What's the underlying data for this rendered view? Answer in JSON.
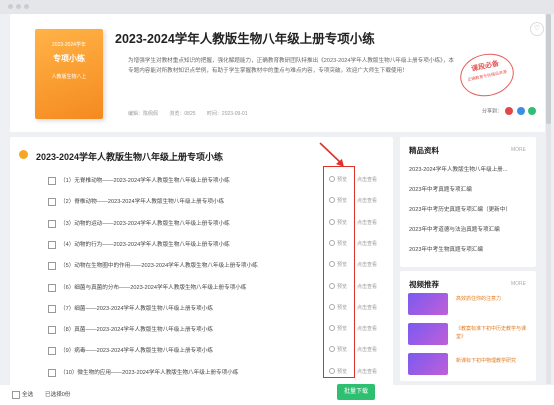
{
  "hero": {
    "title": "2023-2024学年人教版生物八年级上册专项小练",
    "cover": {
      "line1": "2023-2024学年",
      "line2": "专项小练",
      "line3": "人教版生物八上"
    },
    "description": "为增强学生对教材重点知识的把握，强化解题能力，正确教育教研团队特推出《2023-2024学年人教版生物八年级上册专项小练》，本专题内容能对所教材知识点举例，有助于学生掌握教材中的重点与难点内容，专项突破。欢迎广大师生下载使用！",
    "author": "编辑：陈佩佩",
    "views": "浏览：0825",
    "date": "时间：2023-09-01",
    "stamp_big": "课段必备",
    "stamp_small": "正确教育专供精品资源",
    "share_label": "分享到：",
    "colors": {
      "brand_orange": "#f58a1f",
      "accent_green": "#2fbf71",
      "highlight_red": "#e0302a"
    }
  },
  "main": {
    "heading": "2023-2024学年人教版生物八年级上册专项小练",
    "rows": [
      {
        "title": "（1）无脊椎动物——2023-2024学年人教版生物八年级上册专项小练",
        "preview": "预览",
        "view": "点击查看"
      },
      {
        "title": "（2）脊椎动物——2023-2024学年人教版生物八年级上册专项小练",
        "preview": "预览",
        "view": "点击查看"
      },
      {
        "title": "（3）动物的运动——2023-2024学年人教版生物八年级上册专项小练",
        "preview": "预览",
        "view": "点击查看"
      },
      {
        "title": "（4）动物的行为——2023-2024学年人教版生物八年级上册专项小练",
        "preview": "预览",
        "view": "点击查看"
      },
      {
        "title": "（5）动物在生物圈中的作用——2023-2024学年人教版生物八年级上册专项小练",
        "preview": "预览",
        "view": "点击查看"
      },
      {
        "title": "（6）细菌与真菌的分布——2023-2024学年人教版生物八年级上册专项小练",
        "preview": "预览",
        "view": "点击查看"
      },
      {
        "title": "（7）细菌——2023-2024学年人教版生物八年级上册专项小练",
        "preview": "预览",
        "view": "点击查看"
      },
      {
        "title": "（8）真菌——2023-2024学年人教版生物八年级上册专项小练",
        "preview": "预览",
        "view": "点击查看"
      },
      {
        "title": "（9）病毒——2023-2024学年人教版生物八年级上册专项小练",
        "preview": "预览",
        "view": "点击查看"
      },
      {
        "title": "（10）微生物的应用——2023-2024学年人教版生物八年级上册专项小练",
        "preview": "预览",
        "view": "点击查看"
      }
    ]
  },
  "sidebar": {
    "featured": {
      "heading": "精品资料",
      "more": "MORE",
      "items": [
        "2023-2024学年人教版生物八年级上册...",
        "2023年中考真题专项汇编",
        "2023年中考历史真题专项汇编（更新中）",
        "2023年中考道德与法治真题专项汇编",
        "2023年中考生物真题专项汇编"
      ]
    },
    "videos": {
      "heading": "视频推荐",
      "more": "MORE",
      "items": [
        "高效抓住你的注意力",
        "《教案标准下初中历史教学与课堂》",
        "新课标下初中物理教学研究"
      ]
    }
  },
  "bottom": {
    "select_all": "全选",
    "selected": "已选择0份",
    "download": "批量下载"
  }
}
